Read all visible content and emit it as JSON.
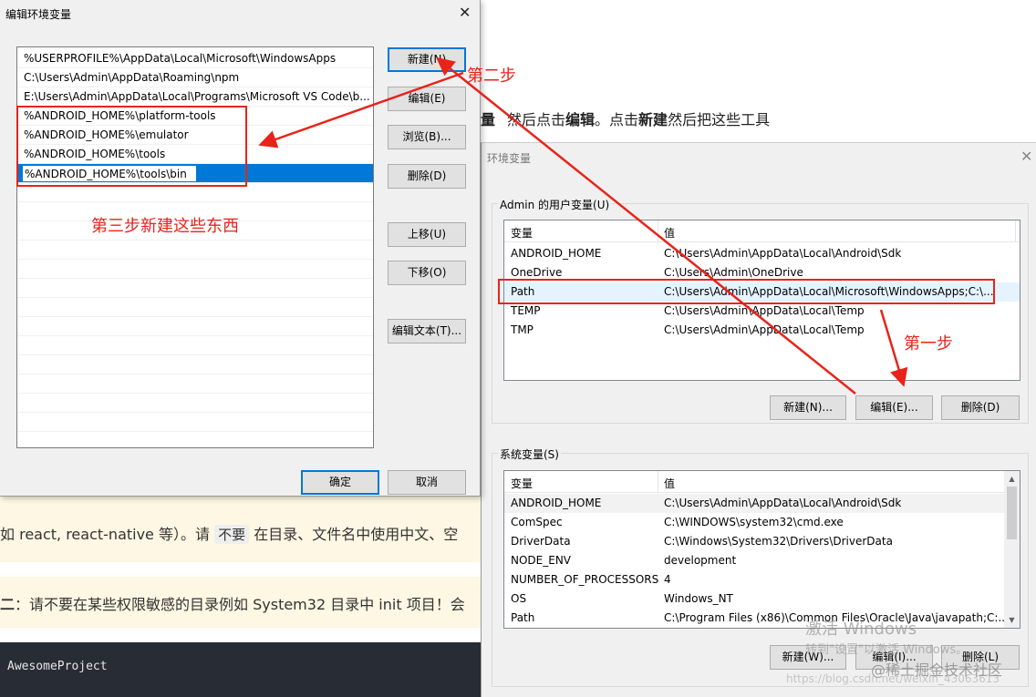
{
  "background_page": {
    "bold_mark": "量",
    "line1_a": "然后点击",
    "line1_edit": "编辑",
    "line1_b": "。点击",
    "line1_new": "新建",
    "line1_c": "然后把这些工具",
    "tip1_a": "如 react, react-native 等）。请",
    "tip1_chip": "不要",
    "tip1_b": "在目录、文件名中使用中文、空",
    "tip2_bold": "二",
    "tip2_text": "：请不要在某些权限敏感的目录例如 System32 目录中 init 项目！会",
    "code_text": "AwesomeProject"
  },
  "env_dialog": {
    "title": "环境变量",
    "user_group_label": "Admin 的用户变量(U)",
    "columns": [
      "变量",
      "值"
    ],
    "user_vars": [
      {
        "name": "ANDROID_HOME",
        "value": "C:\\Users\\Admin\\AppData\\Local\\Android\\Sdk"
      },
      {
        "name": "OneDrive",
        "value": "C:\\Users\\Admin\\OneDrive"
      },
      {
        "name": "Path",
        "value": "C:\\Users\\Admin\\AppData\\Local\\Microsoft\\WindowsApps;C:\\..."
      },
      {
        "name": "TEMP",
        "value": "C:\\Users\\Admin\\AppData\\Local\\Temp"
      },
      {
        "name": "TMP",
        "value": "C:\\Users\\Admin\\AppData\\Local\\Temp"
      }
    ],
    "user_buttons": {
      "new": "新建(N)...",
      "edit": "编辑(E)...",
      "delete": "删除(D)"
    },
    "system_group_label": "系统变量(S)",
    "system_vars": [
      {
        "name": "ANDROID_HOME",
        "value": "C:\\Users\\Admin\\AppData\\Local\\Android\\Sdk"
      },
      {
        "name": "ComSpec",
        "value": "C:\\WINDOWS\\system32\\cmd.exe"
      },
      {
        "name": "DriverData",
        "value": "C:\\Windows\\System32\\Drivers\\DriverData"
      },
      {
        "name": "NODE_ENV",
        "value": "development"
      },
      {
        "name": "NUMBER_OF_PROCESSORS",
        "value": "4"
      },
      {
        "name": "OS",
        "value": "Windows_NT"
      },
      {
        "name": "Path",
        "value": "C:\\Program Files (x86)\\Common Files\\Oracle\\Java\\javapath;C:..."
      }
    ],
    "system_buttons": {
      "new": "新建(W)...",
      "edit": "编辑(I)...",
      "delete": "删除(L)"
    }
  },
  "edit_dialog": {
    "title": "编辑环境变量",
    "paths": [
      "%USERPROFILE%\\AppData\\Local\\Microsoft\\WindowsApps",
      "C:\\Users\\Admin\\AppData\\Roaming\\npm",
      "E:\\Users\\Admin\\AppData\\Local\\Programs\\Microsoft VS Code\\b...",
      "%ANDROID_HOME%\\platform-tools",
      "%ANDROID_HOME%\\emulator",
      "%ANDROID_HOME%\\tools"
    ],
    "editing_value": "%ANDROID_HOME%\\tools\\bin",
    "buttons": {
      "new": "新建(N)",
      "edit": "编辑(E)",
      "browse": "浏览(B)...",
      "delete": "删除(D)",
      "move_up": "上移(U)",
      "move_down": "下移(O)",
      "edit_text": "编辑文本(T)...",
      "ok": "确定",
      "cancel": "取消"
    }
  },
  "annotations": {
    "step1": "第一步",
    "step2": "第二步",
    "step3": "第三步新建这些东西",
    "color": "#e8231a"
  },
  "watermark": {
    "activate_title": "激活 Windows",
    "activate_hint": "转到\"设置\"以激活 Windows。",
    "community": "@稀土掘金技术社区",
    "csdn": "https://blog.csdn.net/weixin_43063613"
  }
}
